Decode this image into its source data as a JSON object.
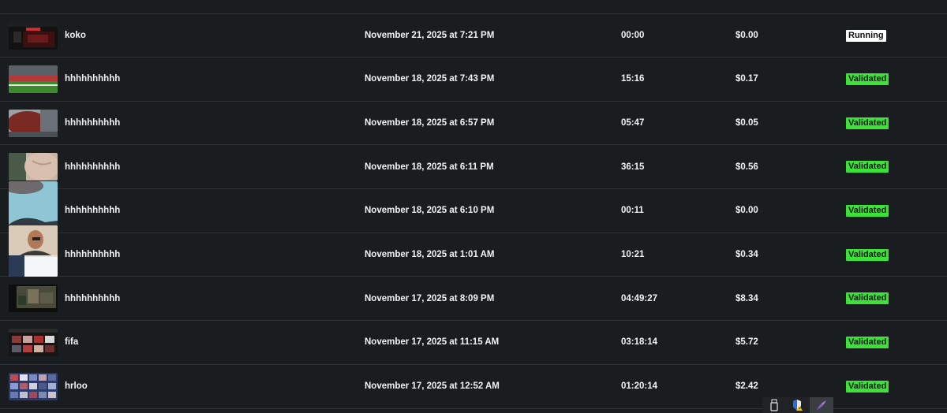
{
  "rows": [
    {
      "name": "koko",
      "date": "November 21, 2025 at 7:21 PM",
      "duration": "00:00",
      "cost": "$0.00",
      "status": "Running"
    },
    {
      "name": "hhhhhhhhhh",
      "date": "November 18, 2025 at 7:43 PM",
      "duration": "15:16",
      "cost": "$0.17",
      "status": "Validated"
    },
    {
      "name": "hhhhhhhhhh",
      "date": "November 18, 2025 at 6:57 PM",
      "duration": "05:47",
      "cost": "$0.05",
      "status": "Validated"
    },
    {
      "name": "hhhhhhhhhh",
      "date": "November 18, 2025 at 6:11 PM",
      "duration": "36:15",
      "cost": "$0.56",
      "status": "Validated"
    },
    {
      "name": "hhhhhhhhhh",
      "date": "November 18, 2025 at 6:10 PM",
      "duration": "00:11",
      "cost": "$0.00",
      "status": "Validated"
    },
    {
      "name": "hhhhhhhhhh",
      "date": "November 18, 2025 at 1:01 AM",
      "duration": "10:21",
      "cost": "$0.34",
      "status": "Validated"
    },
    {
      "name": "hhhhhhhhhh",
      "date": "November 17, 2025 at 8:09 PM",
      "duration": "04:49:27",
      "cost": "$8.34",
      "status": "Validated"
    },
    {
      "name": "fifa",
      "date": "November 17, 2025 at 11:15 AM",
      "duration": "03:18:14",
      "cost": "$5.72",
      "status": "Validated"
    },
    {
      "name": "hrloo",
      "date": "November 17, 2025 at 12:52 AM",
      "duration": "01:20:14",
      "cost": "$2.42",
      "status": "Validated"
    }
  ],
  "colors": {
    "background": "#191d20",
    "divider": "#2c3135",
    "validated": "#3ee03a",
    "running": "#ffffff"
  },
  "taskbar": {
    "icons": [
      "usb-drive-icon",
      "security-shield-icon",
      "pen-feather-icon"
    ]
  }
}
